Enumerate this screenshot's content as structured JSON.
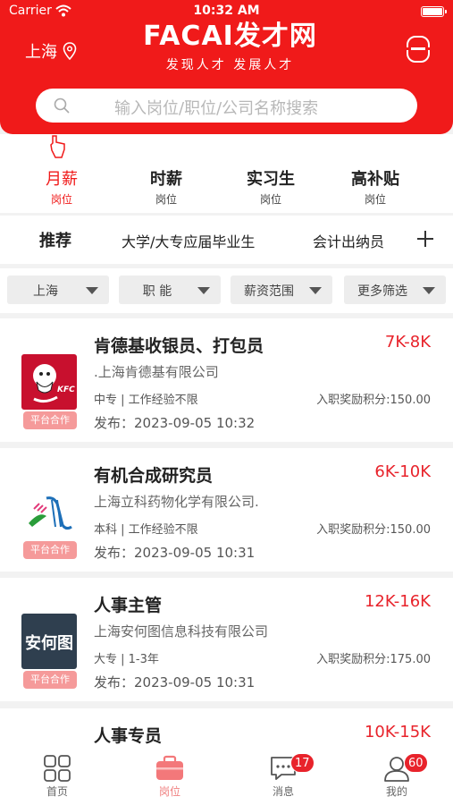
{
  "status_bar": {
    "carrier": "Carrier",
    "time": "10:32 AM"
  },
  "header": {
    "city": "上海",
    "logo_text": "FACAI发才网",
    "slogan": "发现人才  发展人才",
    "brand_color": "#f01a1a"
  },
  "search": {
    "placeholder": "输入岗位/职位/公司名称搜索"
  },
  "type_tabs": [
    {
      "title": "月薪",
      "sub": "岗位",
      "active": true
    },
    {
      "title": "时薪",
      "sub": "岗位",
      "active": false
    },
    {
      "title": "实习生",
      "sub": "岗位",
      "active": false
    },
    {
      "title": "高补贴",
      "sub": "岗位",
      "active": false
    }
  ],
  "categories": {
    "recommend": "推荐",
    "items": [
      "大学/大专应届毕业生",
      "会计出纳员"
    ]
  },
  "filters": [
    "上海",
    "职 能",
    "薪资范围",
    "更多筛选"
  ],
  "jobs": [
    {
      "title": "肯德基收银员、打包员",
      "salary": "7K-8K",
      "company": ".上海肯德基有限公司",
      "meta": "中专 | 工作经验不限",
      "reward": "入职奖励积分:150.00",
      "date": "发布：2023-09-05 10:32",
      "badge": "平台合作",
      "logo": "kfc-logo"
    },
    {
      "title": "有机合成研究员",
      "salary": "6K-10K",
      "company": "上海立科药物化学有限公司.",
      "meta": "本科 | 工作经验不限",
      "reward": "入职奖励积分:150.00",
      "date": "发布：2023-09-05 10:31",
      "badge": "平台合作",
      "logo": "pharma-logo"
    },
    {
      "title": "人事主管",
      "salary": "12K-16K",
      "company": "上海安何图信息科技有限公司",
      "meta": "大专 | 1-3年",
      "reward": "入职奖励积分:175.00",
      "date": "发布：2023-09-05 10:31",
      "badge": "平台合作",
      "logo": "anhetu-logo",
      "logo_text": "安何图"
    },
    {
      "title": "人事专员",
      "salary": "10K-15K"
    }
  ],
  "tabbar": [
    {
      "label": "首页",
      "icon": "grid-icon",
      "active": false
    },
    {
      "label": "岗位",
      "icon": "briefcase-icon",
      "active": true
    },
    {
      "label": "消息",
      "icon": "chat-icon",
      "active": false,
      "badge": "17"
    },
    {
      "label": "我的",
      "icon": "person-icon",
      "active": false,
      "badge": "60"
    }
  ]
}
